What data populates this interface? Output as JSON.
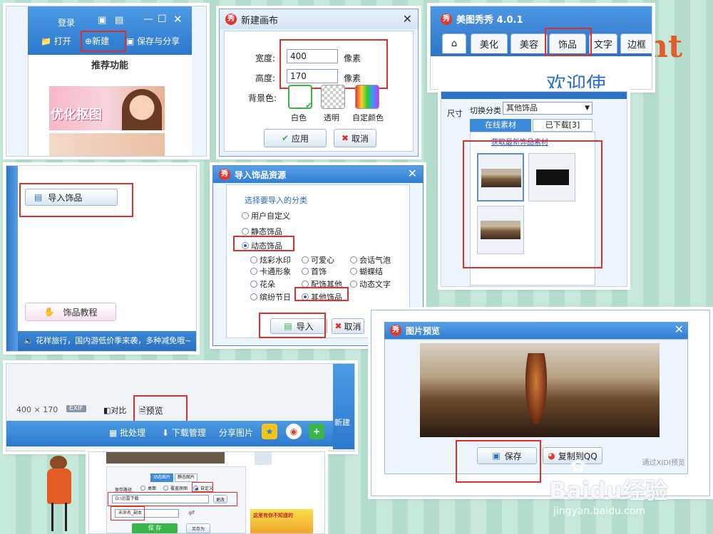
{
  "panel1": {
    "login": "登录",
    "open": "打开",
    "new": "新建",
    "save_share": "保存与分享",
    "recommend_title": "推荐功能",
    "promo_text": "优化抠图"
  },
  "panel2": {
    "title": "新建画布",
    "width_label": "宽度:",
    "width_value": "400",
    "width_unit": "像素",
    "height_label": "高度:",
    "height_value": "170",
    "height_unit": "像素",
    "bg_label": "背景色:",
    "bg_white": "白色",
    "bg_transparent": "透明",
    "bg_custom": "自定颜色",
    "apply": "应用",
    "cancel": "取消"
  },
  "panel3": {
    "title": "美图秀秀 4.0.1",
    "tabs": [
      "美化",
      "美容",
      "饰品",
      "文字",
      "边框"
    ],
    "welcome": "欢迎使"
  },
  "panel3b": {
    "size_label": "尺寸",
    "category_label": "切换分类",
    "category_value": "其他饰品",
    "tab_online": "在线素材",
    "tab_downloaded": "已下载[3]",
    "link": "获取最新饰品素材"
  },
  "panel4": {
    "import_button": "导入饰品",
    "tutorial": "饰品教程",
    "marquee": "花样旅行，国内游低价季来袭，多种减免哦~"
  },
  "panel5": {
    "title": "导入饰品资源",
    "prompt": "选择要导入的分类",
    "cat_custom": "用户自定义",
    "cat_static": "静态饰品",
    "cat_dynamic": "动态饰品",
    "sub": [
      "炫彩水印",
      "可爱心",
      "会话气泡",
      "卡通形象",
      "首饰",
      "蝴蝶结",
      "花朵",
      "配饰其他",
      "动态文字",
      "缤纷节日",
      "其他饰品"
    ],
    "import": "导入",
    "cancel": "取消"
  },
  "panel6": {
    "dimensions": "400 × 170",
    "exif": "EXIF",
    "compare": "对比",
    "preview": "预览",
    "batch": "批处理",
    "download_mgr": "下载管理",
    "share": "分享图片",
    "side_text": "新建"
  },
  "panel7": {
    "title": "图片预览",
    "save": "保存",
    "copy_qq": "复制到QQ",
    "footer": "通过XIDI预览"
  },
  "panel8": {
    "tab1": "动态图片",
    "tab2": "静态图片",
    "path_label": "保存路径",
    "opt_desktop": "桌面",
    "opt_overwrite": "覆盖原图",
    "opt_custom": "自定义",
    "path_value": "D:\\迅雷下载",
    "change": "更改",
    "filename": "未命名_副本",
    "ext": ".gif",
    "save": "保 存",
    "save_as": "另存为",
    "ad": "这里有你不知道的"
  },
  "watermark": {
    "brand": "Baidu经验",
    "url": "jingyan.baidu.com",
    "bg_text": "ht"
  }
}
